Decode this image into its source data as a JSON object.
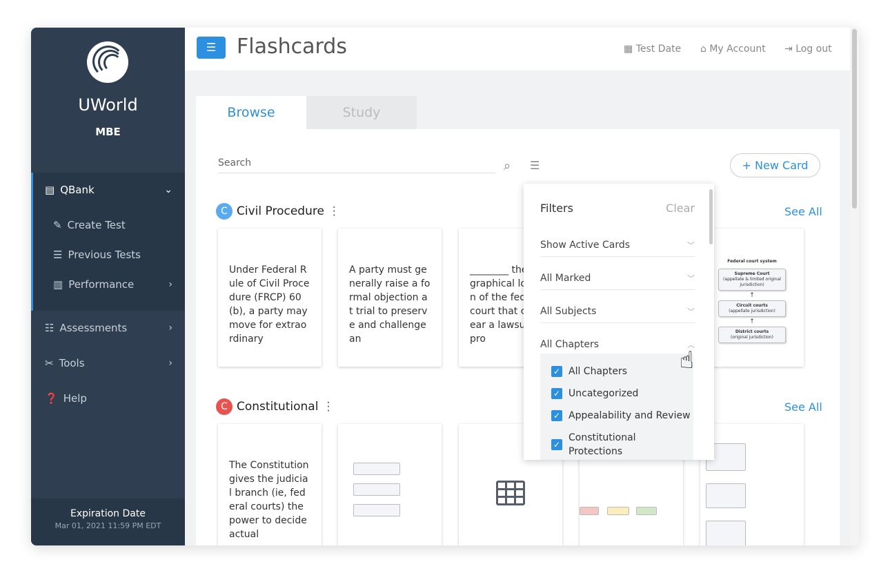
{
  "sidebar": {
    "brand": "UWorld",
    "subtitle": "MBE",
    "items": [
      {
        "label": "QBank",
        "icon": "file-icon"
      },
      {
        "label": "Create Test",
        "icon": "edit-icon"
      },
      {
        "label": "Previous Tests",
        "icon": "list-icon"
      },
      {
        "label": "Performance",
        "icon": "bar-chart-icon"
      },
      {
        "label": "Assessments",
        "icon": "checklist-icon"
      },
      {
        "label": "Tools",
        "icon": "tools-icon"
      },
      {
        "label": "Help",
        "icon": "question-icon"
      }
    ],
    "expiration_label": "Expiration Date",
    "expiration_value": "Mar 01, 2021 11:59 PM EDT"
  },
  "header": {
    "title": "Flashcards",
    "test_date": "Test Date",
    "my_account": "My Account",
    "log_out": "Log out"
  },
  "tabs": [
    {
      "label": "Browse",
      "active": true
    },
    {
      "label": "Study",
      "active": false
    }
  ],
  "search": {
    "placeholder": "Search"
  },
  "new_card": "+ New Card",
  "sections": [
    {
      "badge": "C",
      "badge_color": "#5aaaf0",
      "title": "Civil Procedure",
      "see_all": "See All",
      "cards": [
        "Under Federal Rule of Civil Procedure (FRCP) 60(b), a party may move for extraordinary",
        "A party must generally raise a formal objection at trial to preserve and challenge an",
        "________ the geographical location of the federal court that can hear a lawsuit—is pro"
      ],
      "diagram": {
        "title": "Federal court system",
        "boxes": [
          [
            "Supreme Court",
            "(appellate & limited original jurisdiction)"
          ],
          [
            "Circuit courts",
            "(appellate jurisdiction)"
          ],
          [
            "District courts",
            "(original jurisdiction)"
          ]
        ]
      }
    },
    {
      "badge": "C",
      "badge_color": "#e8534f",
      "title": "Constitutional",
      "see_all": "See All",
      "cards": [
        "The Constitution gives the judicial branch (ie, federal courts) the power to decide actual"
      ]
    }
  ],
  "filters": {
    "title": "Filters",
    "clear": "Clear",
    "rows": [
      "Show Active Cards",
      "All Marked",
      "All Subjects",
      "All Chapters"
    ],
    "chapters": [
      {
        "label": "All Chapters",
        "checked": true
      },
      {
        "label": "Uncategorized",
        "checked": true
      },
      {
        "label": "Appealability and Review",
        "checked": true
      },
      {
        "label": "Constitutional Protections",
        "checked": true
      }
    ]
  },
  "colors": {
    "accent": "#2d8fe0",
    "sidebar": "#2f3e50"
  }
}
